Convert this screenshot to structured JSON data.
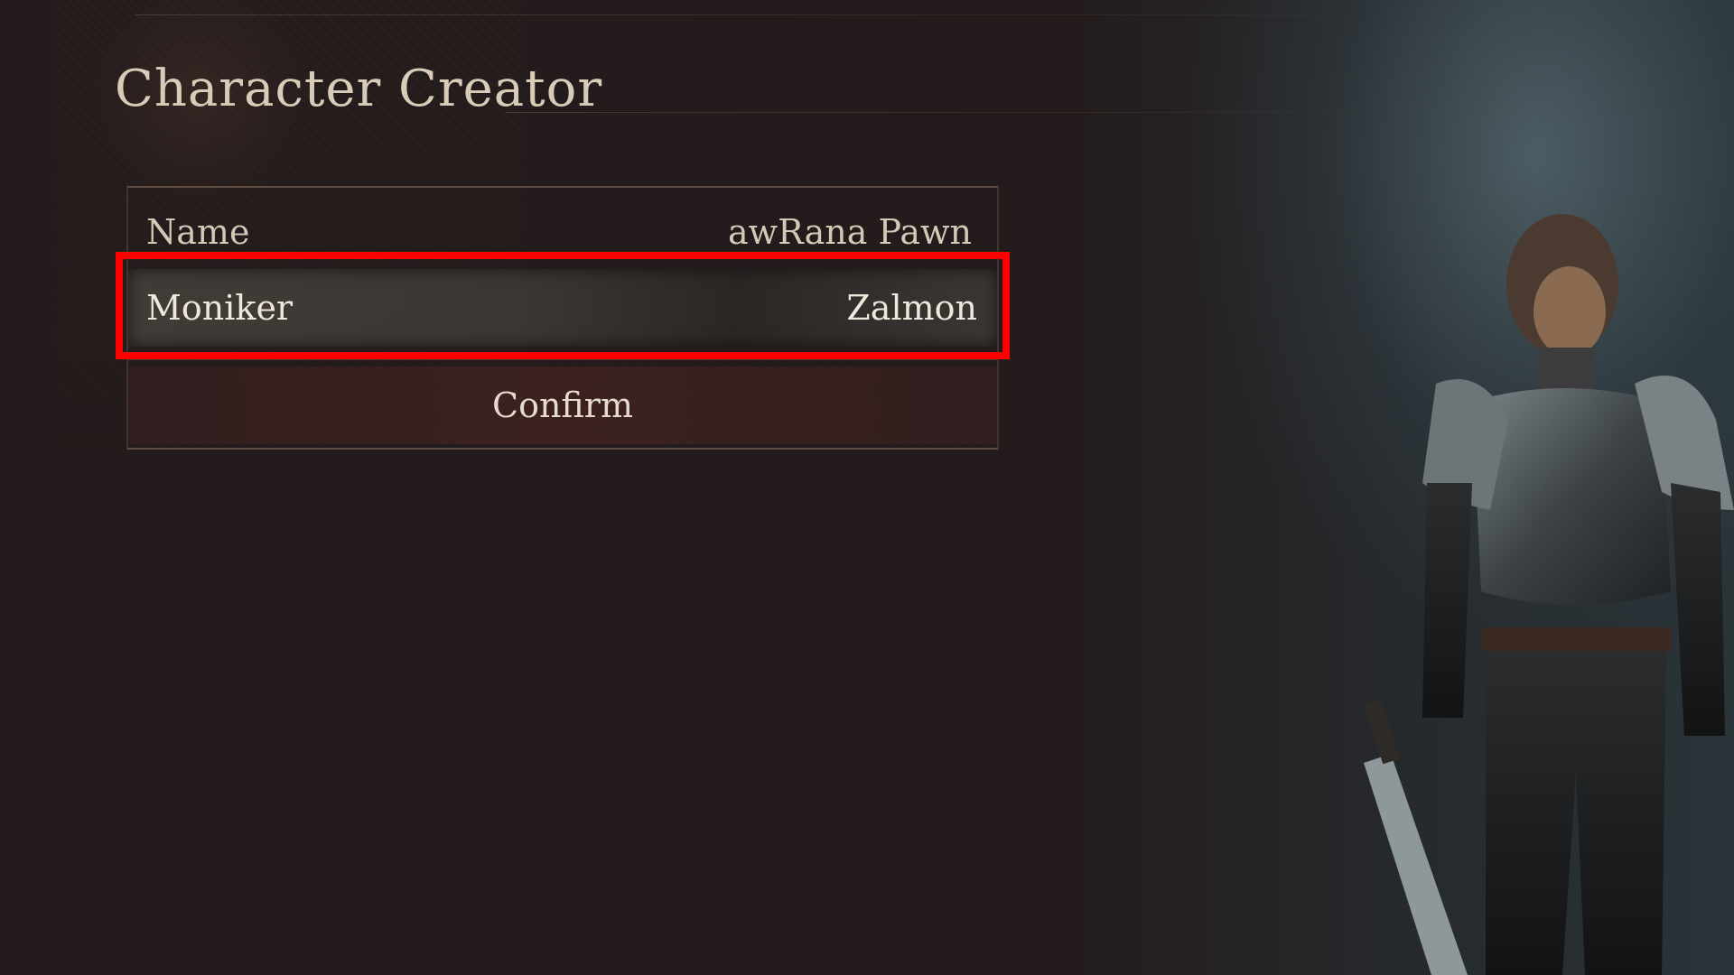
{
  "screen": {
    "title": "Character Creator"
  },
  "form": {
    "rows": [
      {
        "label": "Name",
        "value": "awRana Pawn"
      },
      {
        "label": "Moniker",
        "value": "Zalmon"
      }
    ],
    "confirm_label": "Confirm",
    "selected_row": "Moniker"
  },
  "colors": {
    "highlight": "#ff0000",
    "text": "#d4c9b6",
    "background": "#241c1c"
  },
  "icons": [
    "character-model"
  ]
}
